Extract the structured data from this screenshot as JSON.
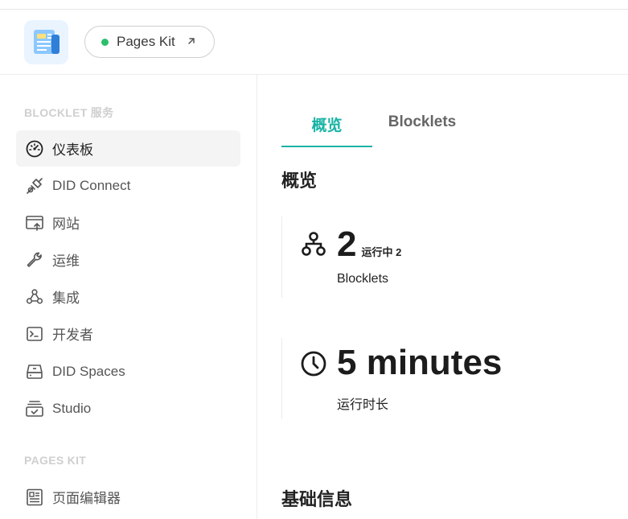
{
  "header": {
    "app_name": "Pages Kit",
    "app_status_color": "#2bbf6b",
    "external_link_icon": "arrow-up-right-icon"
  },
  "sidebar": {
    "section1_title": "BLOCKLET 服务",
    "section1_items": [
      {
        "label": "仪表板",
        "icon": "gauge-icon",
        "active": true
      },
      {
        "label": "DID Connect",
        "icon": "plug-icon"
      },
      {
        "label": "网站",
        "icon": "browser-upload-icon"
      },
      {
        "label": "运维",
        "icon": "wrench-icon"
      },
      {
        "label": "集成",
        "icon": "webhook-icon"
      },
      {
        "label": "开发者",
        "icon": "terminal-icon"
      },
      {
        "label": "DID Spaces",
        "icon": "drive-icon"
      },
      {
        "label": "Studio",
        "icon": "stack-check-icon"
      }
    ],
    "section2_title": "PAGES KIT",
    "section2_items": [
      {
        "label": "页面编辑器",
        "icon": "document-icon"
      }
    ]
  },
  "main": {
    "tabs": [
      {
        "label": "概览",
        "active": true
      },
      {
        "label": "Blocklets"
      }
    ],
    "overview_title": "概览",
    "stats": [
      {
        "icon": "hierarchy-icon",
        "value": "2",
        "sub": "运行中 2",
        "label": "Blocklets"
      },
      {
        "icon": "clock-icon",
        "value": "5 minutes",
        "label": "运行时长"
      }
    ],
    "basic_info_title": "基础信息"
  },
  "colors": {
    "accent": "#19b3a5",
    "active_nav_bg": "#f4f4f4",
    "section_title": "#cfcfcf"
  }
}
